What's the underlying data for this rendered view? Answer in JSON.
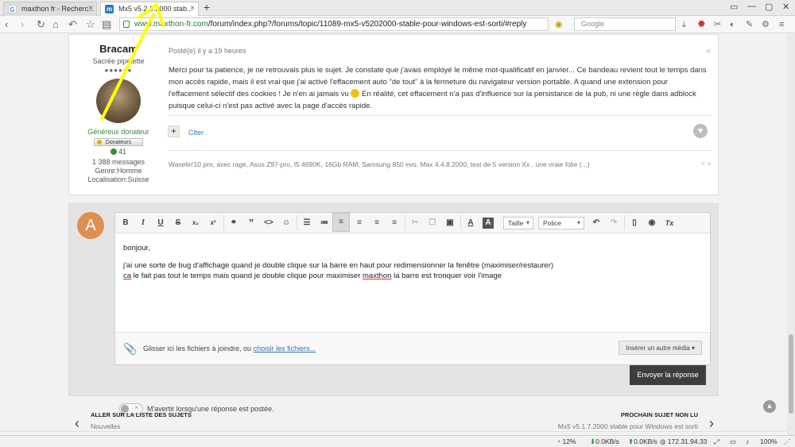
{
  "browser": {
    "tabs": [
      {
        "label": "maxthon fr - Recherc...",
        "favicon": "G",
        "favicon_color": "#4285f4",
        "active": false
      },
      {
        "label": "Mx5 v5.2.0.2000 stab...",
        "favicon": "m",
        "favicon_color": "#2b79c2",
        "active": true
      }
    ],
    "new_tab": "+",
    "url_domain": "www.maxthon-fr.com",
    "url_path": "/forum/index.php?/forums/topic/11089-mx5-v5202000-stable-pour-windows-est-sorti/#reply",
    "search_placeholder": "Google",
    "window_controls": [
      "▭",
      "—",
      "▢",
      "✕"
    ]
  },
  "post": {
    "author_name": "Bracam",
    "author_title": "Sacrée pipelette",
    "author_dots": "●●●●●●",
    "author_group": "Généreux donateur",
    "donor_badge": "Donateurs",
    "reputation": "41",
    "messages": "1 388 messages",
    "genre": "Genre:Homme",
    "localisation": "Localisation:Suisse",
    "posted": "Posté(e) il y a 19 heures",
    "body_part1": "Merci pour ta patience, je ne retrouvais plus le sujet. Je constate que j'avais employé le même mot-qualificatif en janvier... Ce bandeau revient tout le temps dans mon accès rapide, mais il est vrai que j'ai activé l'effacement auto \"de tout\" à la fermeture du navigateur version portable. A quand une extension pour l'effacement sélectif des cookies ! Je n'en ai jamais vu",
    "body_part2": "En réalité, cet effacement n'a pas d'influence sur la persistance de la pub, ni une règle dans adblock puisque celui-ci n'est pas activé avec la page d'accès rapide.",
    "quote_label": "Citer",
    "signature": "Waselin'10 pro, avec rage, Asus Z97-pro, I5 4690K, 16Gb RAM, Samsung 850 evo, Max 4.4.8.2000, test de 5 version Xx , une vraie folie (...)"
  },
  "reply": {
    "avatar_letter": "A",
    "toolbar": {
      "bold": "B",
      "italic": "I",
      "underline": "U",
      "strike": "S",
      "subscript": "x₂",
      "superscript": "x²",
      "size_label": "Taille",
      "font_label": "Police",
      "clear_format": "Tx"
    },
    "content": {
      "line1": "bonjour,",
      "line2": "j'ai une sorte de bug d'affichage quand je double clique sur la barre en haut pour redimensionner la fenêtre (maximiser/restaurer)",
      "line3_a": "ca",
      "line3_b": " le fait pas tout le temps mais quand je double clique pour maximiser ",
      "line3_c": "maxthon",
      "line3_d": " la barre est tronquer voir l'image"
    },
    "attach_text": "Glisser ici les fichiers à joindre, ou ",
    "attach_link": "choisir les fichiers...",
    "insert_media": "Insérer un autre média ▾",
    "notify_text": "M'avertir lorsqu'une réponse est postée.",
    "send_label": "Envoyer la réponse"
  },
  "pagination": {
    "prev_label": "ALLER SUR LA LISTE DES SUJETS",
    "prev_sub": "Nouvelles",
    "next_label": "PROCHAIN SUJET NON LU",
    "next_sub": "Mx5 v5.1.7.2000 stable pour Windows est sorti"
  },
  "statusbar": {
    "cpu": "12%",
    "down": "0.0KB/s",
    "up": "0.0KB/s",
    "ip": "172.31.94.33",
    "zoom": "100%"
  },
  "colors": {
    "annotation_arrow": "#ffff00",
    "send_button": "#3d3d3d",
    "avatar_reply": "#e28e50"
  }
}
